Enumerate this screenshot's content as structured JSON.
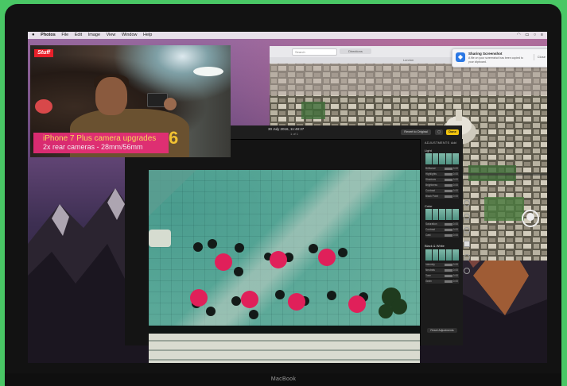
{
  "menubar": {
    "apple": "",
    "app": "Photos",
    "items": [
      "File",
      "Edit",
      "Image",
      "View",
      "Window",
      "Help"
    ]
  },
  "maps": {
    "search_placeholder": "Search",
    "directions_label": "Directions",
    "window_title": "London"
  },
  "notification": {
    "title": "Sharing Screenshot",
    "body": "A file on your screenshot has been copied to your clipboard.",
    "close_label": "Close"
  },
  "video": {
    "logo": "Stuff",
    "headline": "iPhone 7 Plus camera upgrades",
    "subline": "2x rear cameras - 28mm/56mm",
    "number": "6"
  },
  "photos": {
    "date": "30 July 2016, 11:48:37",
    "subtitle": "1 of 1",
    "revert_label": "Revert to Original",
    "done_label": "Done"
  },
  "adjust": {
    "title": "ADJUSTMENTS",
    "add_label": "Add",
    "light_label": "Light",
    "color_label": "Color",
    "bw_label": "Black & White",
    "reset_label": "Reset Adjustments",
    "light_rows": [
      "Brilliance",
      "Highlights",
      "Shadows",
      "Brightness",
      "Contrast",
      "Black Point"
    ],
    "light_values": [
      "0.00",
      "0.00",
      "0.00",
      "0.00",
      "0.00",
      "0.00"
    ],
    "color_rows": [
      "Saturation",
      "Contrast",
      "Cast"
    ],
    "color_values": [
      "0.00",
      "0.00",
      "0.00"
    ],
    "bw_rows": [
      "Intensity",
      "Neutrals",
      "Tone",
      "Grain"
    ],
    "bw_values": [
      "0.00",
      "0.00",
      "0.00",
      "0.00"
    ]
  },
  "device_label": "MacBook"
}
